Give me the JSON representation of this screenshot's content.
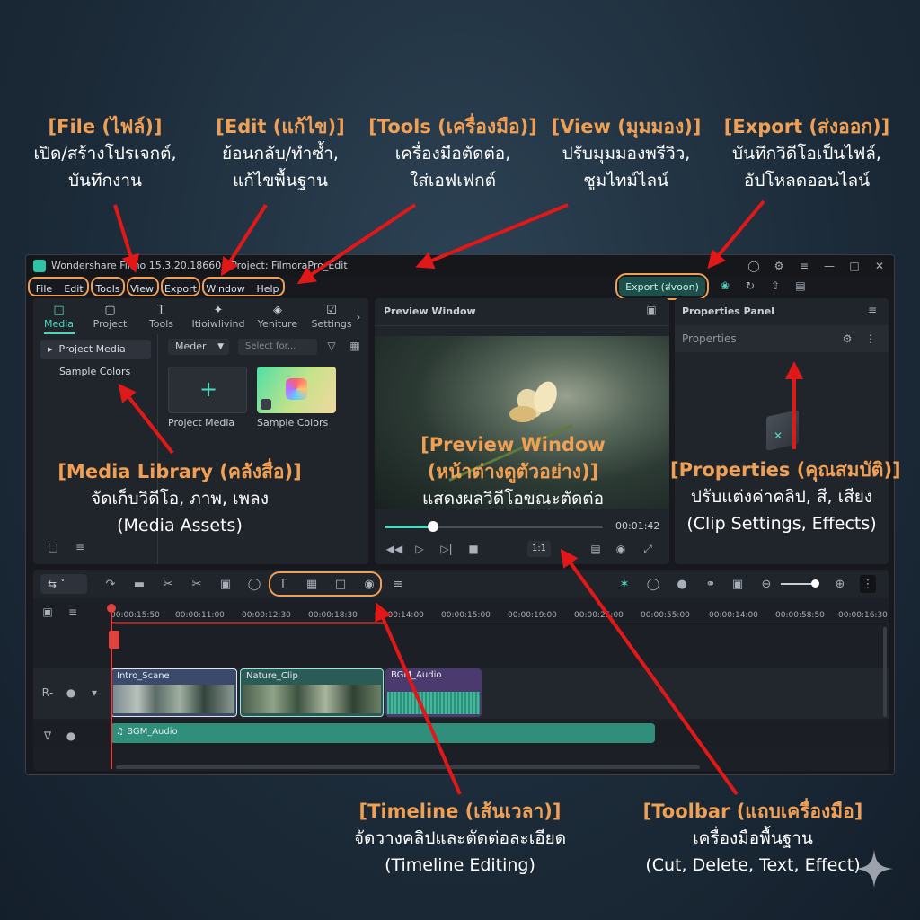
{
  "colors": {
    "accent": "#4fd8c0",
    "callout_title": "#f0a054",
    "arrow": "#e01818",
    "playhead": "#e0433d"
  },
  "callouts": {
    "file": {
      "title": "[File (ไฟล์)]",
      "line1": "เปิด/สร้างโปรเจกต์,",
      "line2": "บันทึกงาน"
    },
    "edit": {
      "title": "[Edit (แก้ไข)]",
      "line1": "ย้อนกลับ/ทำซ้ำ,",
      "line2": "แก้ไขพื้นฐาน"
    },
    "tools": {
      "title": "[Tools (เครื่องมือ)]",
      "line1": "เครื่องมือตัดต่อ,",
      "line2": "ใส่เอฟเฟกต์"
    },
    "view": {
      "title": "[View (มุมมอง)]",
      "line1": "ปรับมุมมองพรีวิว,",
      "line2": "ซูมไทม์ไลน์"
    },
    "export": {
      "title": "[Export (ส่งออก)]",
      "line1": "บันทึกวิดีโอเป็นไฟล์,",
      "line2": "อัปโหลดออนไลน์"
    },
    "media": {
      "title": "[Media Library (คลังสื่อ)]",
      "line1": "จัดเก็บวิดีโอ, ภาพ, เพลง",
      "line2": "(Media Assets)"
    },
    "preview": {
      "title": "[Preview Window",
      "line1": "(หน้าต่างดูตัวอย่าง)]",
      "line2": "แสดงผลวิดีโอขณะตัดต่อ"
    },
    "properties": {
      "title": "[Properties (คุณสมบัติ)]",
      "line1": "ปรับแต่งค่าคลิป, สี, เสียง",
      "line2": "(Clip Settings, Effects)"
    },
    "timeline": {
      "title": "[Timeline (เส้นเวลา)]",
      "line1": "จัดวางคลิปและตัดต่อละเอียด",
      "line2": "(Timeline Editing)"
    },
    "toolbar": {
      "title": "[Toolbar (แถบเครื่องมือ]",
      "line1": "เครื่องมือพื้นฐาน",
      "line2": "(Cut, Delete, Text, Effect)"
    }
  },
  "window": {
    "title": "Wondershare Filmo 15.3.20.18660 - Project: FilmoraPro_Edit",
    "export_button": "Export (ส่voon)"
  },
  "menu": [
    "File",
    "Edit",
    "Tools",
    "View",
    "Export",
    "Window",
    "Help"
  ],
  "media_panel": {
    "tabs": [
      {
        "label": "Media",
        "icon": "folder-icon"
      },
      {
        "label": "Project",
        "icon": "monitor-icon"
      },
      {
        "label": "Tools",
        "icon": "text-icon"
      },
      {
        "label": "Itioiwlivind",
        "icon": "sparkle-icon"
      },
      {
        "label": "Yeniture",
        "icon": "shapes-icon"
      },
      {
        "label": "Settings",
        "icon": "settings-icon"
      }
    ],
    "sidebar": [
      "Project Media",
      "Sample Colors"
    ],
    "filter_dropdown": "Meder",
    "search_placeholder": "Select for...",
    "items": [
      "Project Media",
      "Sample Colors"
    ]
  },
  "preview": {
    "title": "Preview Window",
    "time": "00:01:42",
    "ratio": "1:1",
    "progress": 0.22
  },
  "properties": {
    "panel_title": "Properties Panel",
    "subtitle": "Properties"
  },
  "timeline": {
    "ruler": [
      "00:00:15:50",
      "00:00:11:00",
      "00:00:12:30",
      "00:00:18:30",
      "00:00:14:00",
      "00:00:15:00",
      "00:00:19:00",
      "00:00:25:00",
      "00:00:55:00",
      "00:00:14:00",
      "00:00:58:50",
      "00:00:16:30"
    ],
    "clips": [
      {
        "name": "Intro_Scane"
      },
      {
        "name": "Nature_Clip"
      },
      {
        "name": "BGM_Audio"
      }
    ],
    "audio_clip": "BGM_Audio"
  }
}
